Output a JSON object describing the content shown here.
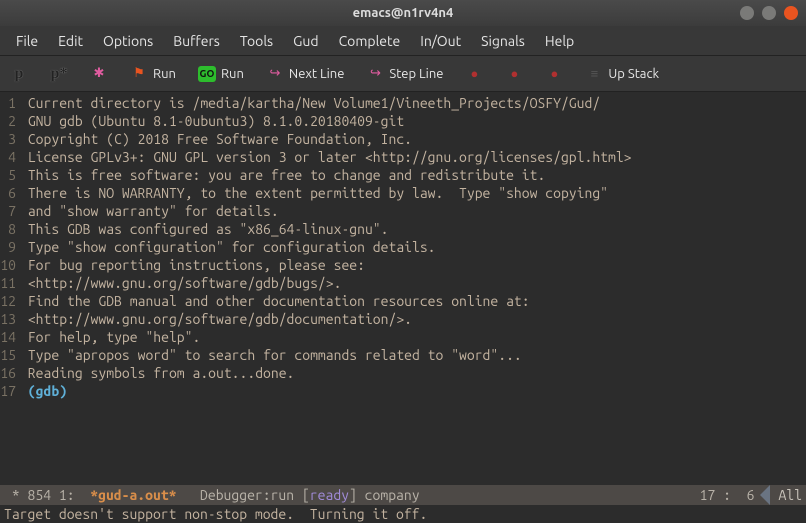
{
  "window": {
    "title": "emacs@n1rv4n4"
  },
  "menubar": {
    "items": [
      "File",
      "Edit",
      "Options",
      "Buffers",
      "Tools",
      "Gud",
      "Complete",
      "In/Out",
      "Signals",
      "Help"
    ]
  },
  "toolbar": {
    "items": [
      {
        "name": "break-p",
        "label": "",
        "icon": "p",
        "iconClass": "tb-p"
      },
      {
        "name": "break-pstar",
        "label": "",
        "icon": "p*",
        "iconClass": "tb-pstar"
      },
      {
        "name": "bug-icon",
        "label": "",
        "icon": "✱",
        "iconClass": "ico-pink"
      },
      {
        "name": "run-flag",
        "label": "Run",
        "icon": "⚑",
        "iconClass": "ico-flag"
      },
      {
        "name": "run-go",
        "label": "Run",
        "icon": "GO",
        "iconClass": "ico-go"
      },
      {
        "name": "next-line",
        "label": "Next Line",
        "icon": "↪",
        "iconClass": "ico-pink"
      },
      {
        "name": "step-line",
        "label": "Step Line",
        "icon": "↪",
        "iconClass": "ico-pink"
      },
      {
        "name": "bp1",
        "label": "",
        "icon": "●",
        "iconClass": "ico-red"
      },
      {
        "name": "bp2",
        "label": "",
        "icon": "●",
        "iconClass": "ico-red"
      },
      {
        "name": "bp3",
        "label": "",
        "icon": "●",
        "iconClass": "ico-red"
      },
      {
        "name": "up-stack",
        "label": "Up Stack",
        "icon": "≡",
        "iconClass": "ico-stack"
      }
    ]
  },
  "buffer": {
    "lines": [
      "Current directory is /media/kartha/New Volume1/Vineeth_Projects/OSFY/Gud/",
      "GNU gdb (Ubuntu 8.1-0ubuntu3) 8.1.0.20180409-git",
      "Copyright (C) 2018 Free Software Foundation, Inc.",
      "License GPLv3+: GNU GPL version 3 or later <http://gnu.org/licenses/gpl.html>",
      "This is free software: you are free to change and redistribute it.",
      "There is NO WARRANTY, to the extent permitted by law.  Type \"show copying\"",
      "and \"show warranty\" for details.",
      "This GDB was configured as \"x86_64-linux-gnu\".",
      "Type \"show configuration\" for configuration details.",
      "For bug reporting instructions, please see:",
      "<http://www.gnu.org/software/gdb/bugs/>.",
      "Find the GDB manual and other documentation resources online at:",
      "<http://www.gnu.org/software/gdb/documentation/>.",
      "For help, type \"help\".",
      "Type \"apropos word\" to search for commands related to \"word\"...",
      "Reading symbols from a.out...done."
    ],
    "prompt": "(gdb) "
  },
  "statusbar": {
    "indicator": " * ",
    "size": "854",
    "colpos": " 1:  ",
    "buffer_name": "*gud-a.out*",
    "mode_prefix": "   Debugger:run [",
    "ready": "ready",
    "mode_suffix": "] company",
    "cursor": "17 :  6",
    "scroll": "All"
  },
  "echo": "Target doesn't support non-stop mode.  Turning it off."
}
